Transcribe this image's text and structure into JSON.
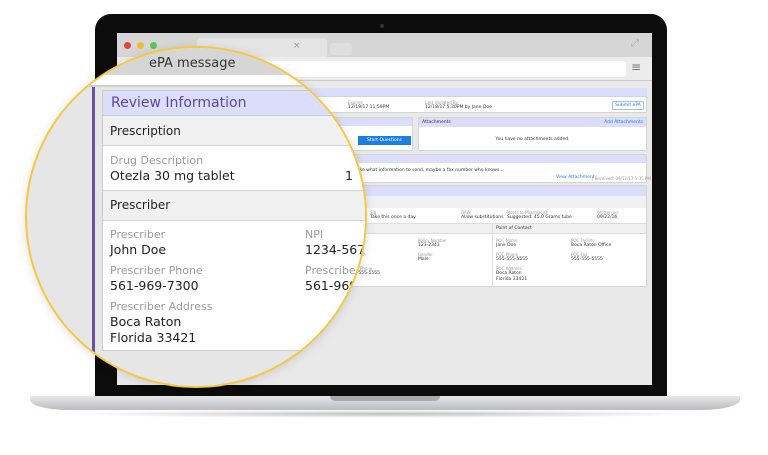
{
  "browser": {
    "tab_title": "ePA message",
    "close_glyph": "×"
  },
  "summary": {
    "expires_label": "Expires",
    "expires_value": "12/19/17 11:59PM",
    "updated_label": "Last Updated By",
    "updated_value": "12/18/17 5:30PM by Jane Doe",
    "submit_label": "Submit ePA"
  },
  "questions": {
    "start_label": "Start Questions"
  },
  "attachments": {
    "title": "Attachments",
    "add_label": "Add Attachments",
    "empty_text": "You have no attachments added."
  },
  "message": {
    "text": "A. Like what information to send, maybe a fax number who knows...",
    "view_label": "View Attachment",
    "received": "| Received: 09/12/17 5:35 PM"
  },
  "prescription_row": [
    {
      "label": "Sig",
      "value": "Take this once a day"
    },
    {
      "label": "DAW",
      "value": "Allow substitutions"
    },
    {
      "label": "Notes to Pharmacist",
      "value": "Suggested: 45.0 Grams tube"
    },
    {
      "label": "Written on",
      "value": "09/22/16"
    }
  ],
  "patient": {
    "name_label": "Name",
    "name_value": "Doe",
    "policy_label": "Policy Number",
    "policy_value": "123-2343",
    "dob_label": "of Birth",
    "dob_value": "3/78",
    "gender_label": "Gender",
    "gender_value": "Male",
    "phone_label": "ient Phone",
    "phone_value": "55-555-5555"
  },
  "poc": {
    "title": "Point of Contact",
    "name_label": "POC Name",
    "name_value": "Jane Doe",
    "facility_label": "POC Facility",
    "facility_value": "Boca Raton Office",
    "phone_label": "POC Phone",
    "phone_value": "555-555-5555",
    "fax_label": "POC Fax",
    "fax_value": "555-555-5555",
    "address_label": "POC Address",
    "address_line1": "Boca Raton",
    "address_line2": "Florida 33421"
  },
  "review": {
    "title": "Review Information",
    "prescription_header": "Prescription",
    "drug_label": "Drug Description",
    "drug_value": "Otezla 30 mg tablet",
    "prescriber_header": "Prescriber",
    "prescriber_label": "Prescriber",
    "prescriber_value": "John Doe",
    "npi_label": "NPI",
    "npi_value": "1234-567",
    "phone_label": "Prescriber Phone",
    "phone_value": "561-969-7300",
    "fax_label": "Prescribe",
    "fax_value": "561-969",
    "address_label": "Prescriber Address",
    "address_line1": "Boca Raton",
    "address_line2": "Florida 33421",
    "partial_digit": "1"
  },
  "colors": {
    "accent": "#5a4a9a",
    "header": "#dcdcfb",
    "button": "#1a7fe0",
    "magnifier_ring": "#f5c842"
  }
}
